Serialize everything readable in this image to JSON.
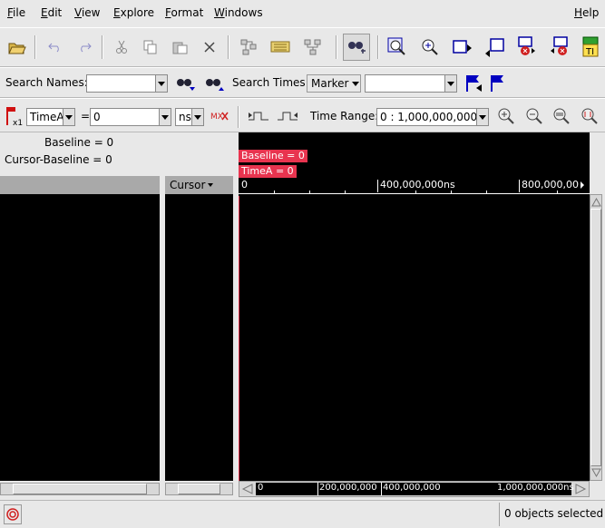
{
  "menubar": {
    "items": [
      "File",
      "Edit",
      "View",
      "Explore",
      "Format",
      "Windows"
    ],
    "help": "Help"
  },
  "toolbar": {
    "icons": [
      "open-folder-icon",
      "undo-icon",
      "redo-icon",
      "cut-icon",
      "copy-icon",
      "paste-icon",
      "delete-icon",
      "group-icon",
      "bus-icon",
      "ungroup-icon",
      "find-icon",
      "zoom-fit-icon",
      "zoom-in-icon",
      "marker-left-icon",
      "marker-right-icon",
      "cursor-left-icon",
      "cursor-right-icon",
      "ruler-icon"
    ]
  },
  "search": {
    "names_label": "Search Names:",
    "names_value": "",
    "times_label": "Search Times:",
    "times_mode": "Marker",
    "times_value": ""
  },
  "cursor_bar": {
    "marker_name": "TimeA",
    "equals": "=",
    "time_value": "0",
    "time_unit": "ns",
    "x1_label": "x1",
    "time_range_label": "Time Range:",
    "time_range_value": "0 : 1,000,000,000n"
  },
  "info": {
    "baseline": "Baseline  =  0",
    "cursor_baseline": "Cursor-Baseline  =  0"
  },
  "columns": {
    "cursor_header": "Cursor"
  },
  "waveform": {
    "markers": [
      "Baseline = 0",
      "TimeA = 0"
    ],
    "top_ruler": [
      "0",
      "400,000,000ns",
      "800,000,00"
    ],
    "bottom_ruler": [
      "0",
      "200,000,000",
      "400,000,000",
      "1,000,000,000ns"
    ]
  },
  "status": {
    "text": "0 objects selected"
  },
  "colors": {
    "marker": "#e8344f",
    "background": "#000000",
    "chrome": "#e8e8e8"
  }
}
